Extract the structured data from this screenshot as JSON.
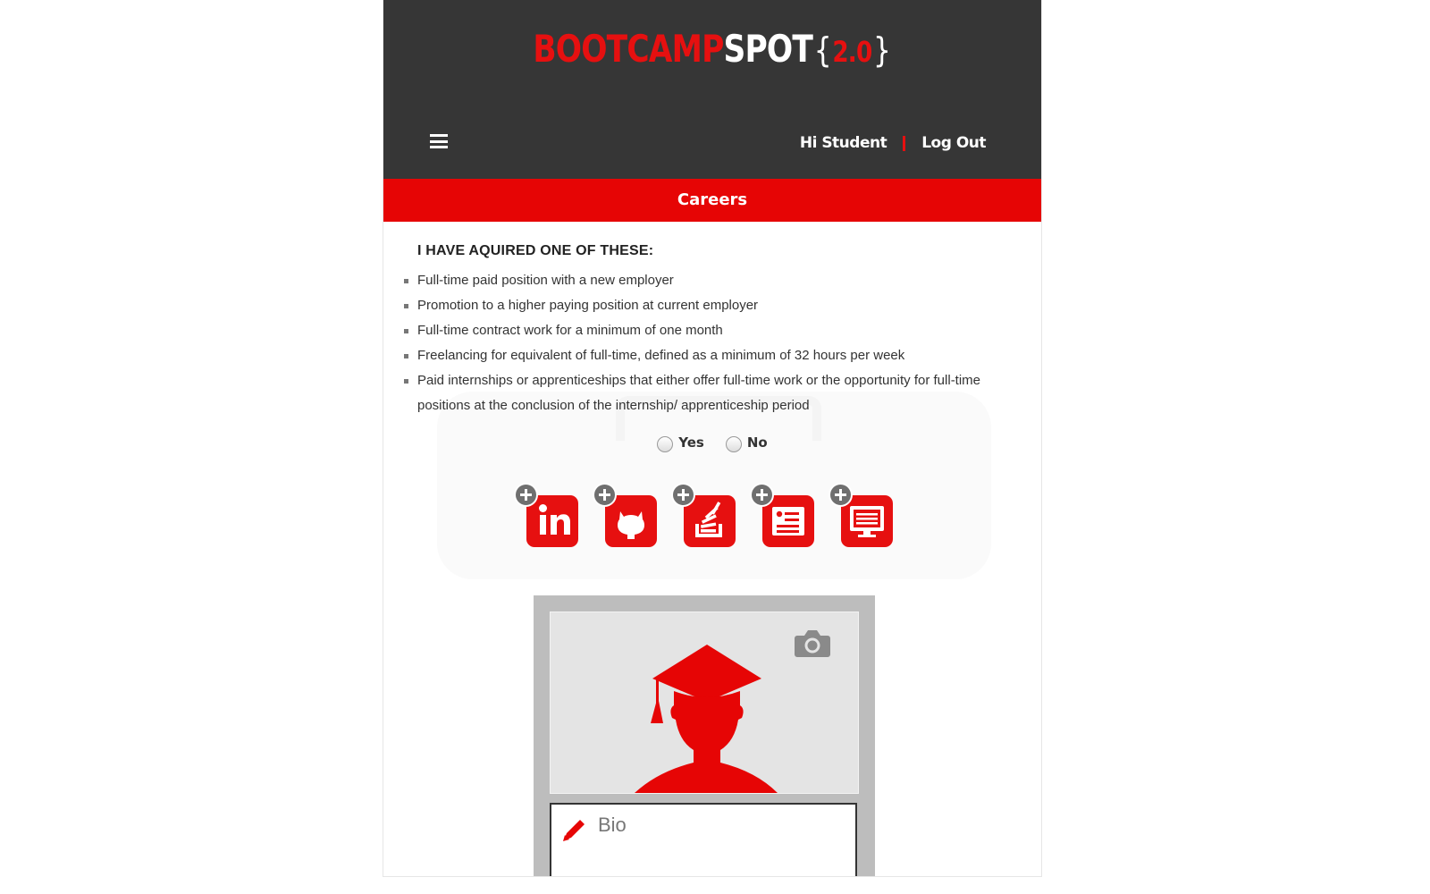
{
  "header": {
    "logo_part1": "BOOTCAMP",
    "logo_part2": "SPOT",
    "logo_brace_open": "{",
    "logo_version": "2.0",
    "logo_brace_close": "}",
    "greeting": "Hi Student",
    "logout_label": "Log Out"
  },
  "subbar": {
    "title": "Careers"
  },
  "criteria": {
    "title": "I HAVE AQUIRED ONE OF THESE:",
    "items": [
      "Full-time paid position with a new employer",
      "Promotion to a higher paying position at current employer",
      "Full-time contract work for a minimum of one month",
      "Freelancing for equivalent of full-time, defined as a minimum of 32 hours per week",
      "Paid internships or apprenticeships that either offer full-time work or the opportunity for full-time positions at the conclusion of the internship/ apprenticeship period"
    ]
  },
  "radio": {
    "yes_label": "Yes",
    "no_label": "No"
  },
  "social": {
    "icons": [
      "linkedin-icon",
      "github-icon",
      "stackoverflow-icon",
      "resume-icon",
      "portfolio-icon"
    ],
    "linkedin_text": "in"
  },
  "profile": {
    "bio_label": "Bio"
  },
  "colors": {
    "accent": "#e61010",
    "header_bg": "#363636",
    "card_bg": "#bdbdbd"
  }
}
